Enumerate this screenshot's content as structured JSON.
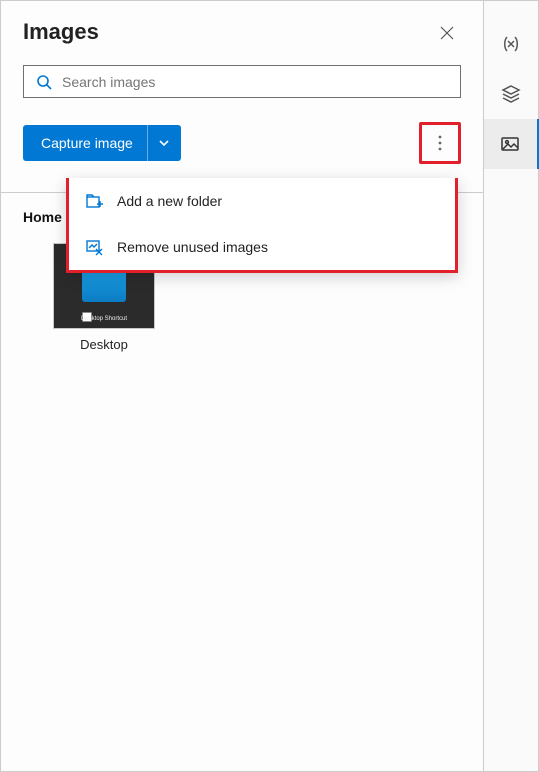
{
  "header": {
    "title": "Images"
  },
  "search": {
    "placeholder": "Search images"
  },
  "capture": {
    "label": "Capture image"
  },
  "menu": {
    "items": [
      {
        "label": "Add a new folder"
      },
      {
        "label": "Remove unused images"
      }
    ]
  },
  "breadcrumb": "Home",
  "thumbnails": [
    {
      "caption": "Desktop",
      "mini_label": "Desktop Shortcut"
    }
  ],
  "toolbar": {
    "items": [
      {
        "name": "variables",
        "active": false
      },
      {
        "name": "layers",
        "active": false
      },
      {
        "name": "images",
        "active": true
      }
    ]
  }
}
